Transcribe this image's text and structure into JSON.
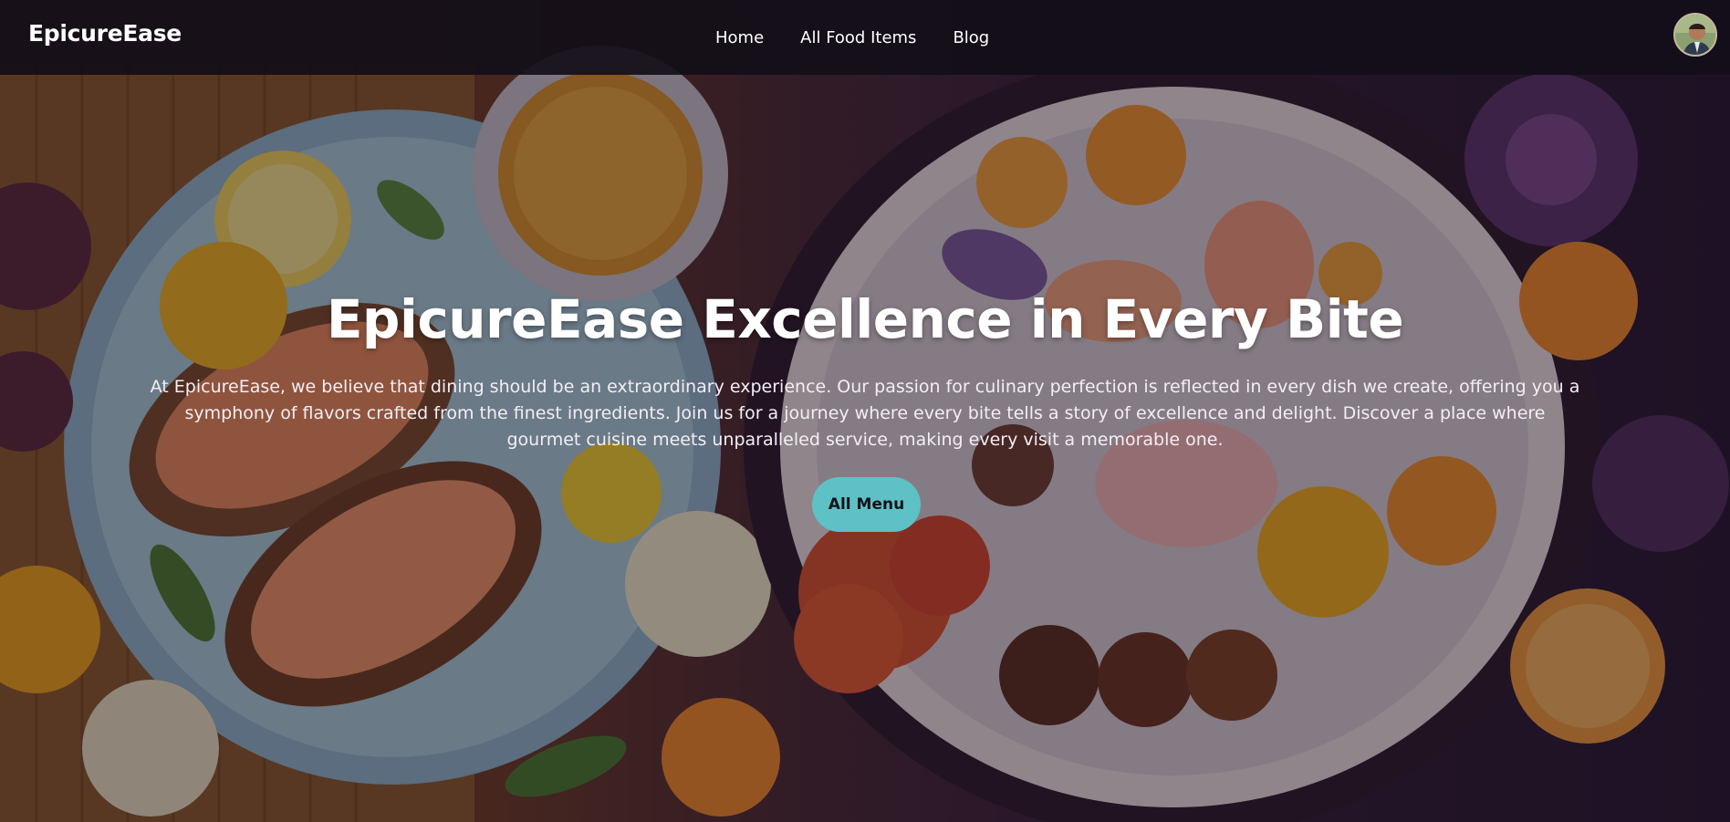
{
  "navbar": {
    "brand": "EpicureEase",
    "links": [
      {
        "label": "Home"
      },
      {
        "label": "All Food Items"
      },
      {
        "label": "Blog"
      }
    ],
    "avatar_icon": "user-avatar"
  },
  "hero": {
    "headline": "EpicureEase Excellence in Every Bite",
    "description": "At EpicureEase, we believe that dining should be an extraordinary experience. Our passion for culinary perfection is reflected in every dish we create, offering you a symphony of flavors crafted from the finest ingredients. Join us for a journey where every bite tells a story of excellence and delight. Discover a place where gourmet cuisine meets unparalleled service, making every visit a memorable one.",
    "cta_label": "All Menu",
    "background_icon": "food-platter-image"
  },
  "colors": {
    "navbar_bg": "#120e18",
    "cta_bg": "#5ec1c6",
    "text": "#ffffff"
  }
}
